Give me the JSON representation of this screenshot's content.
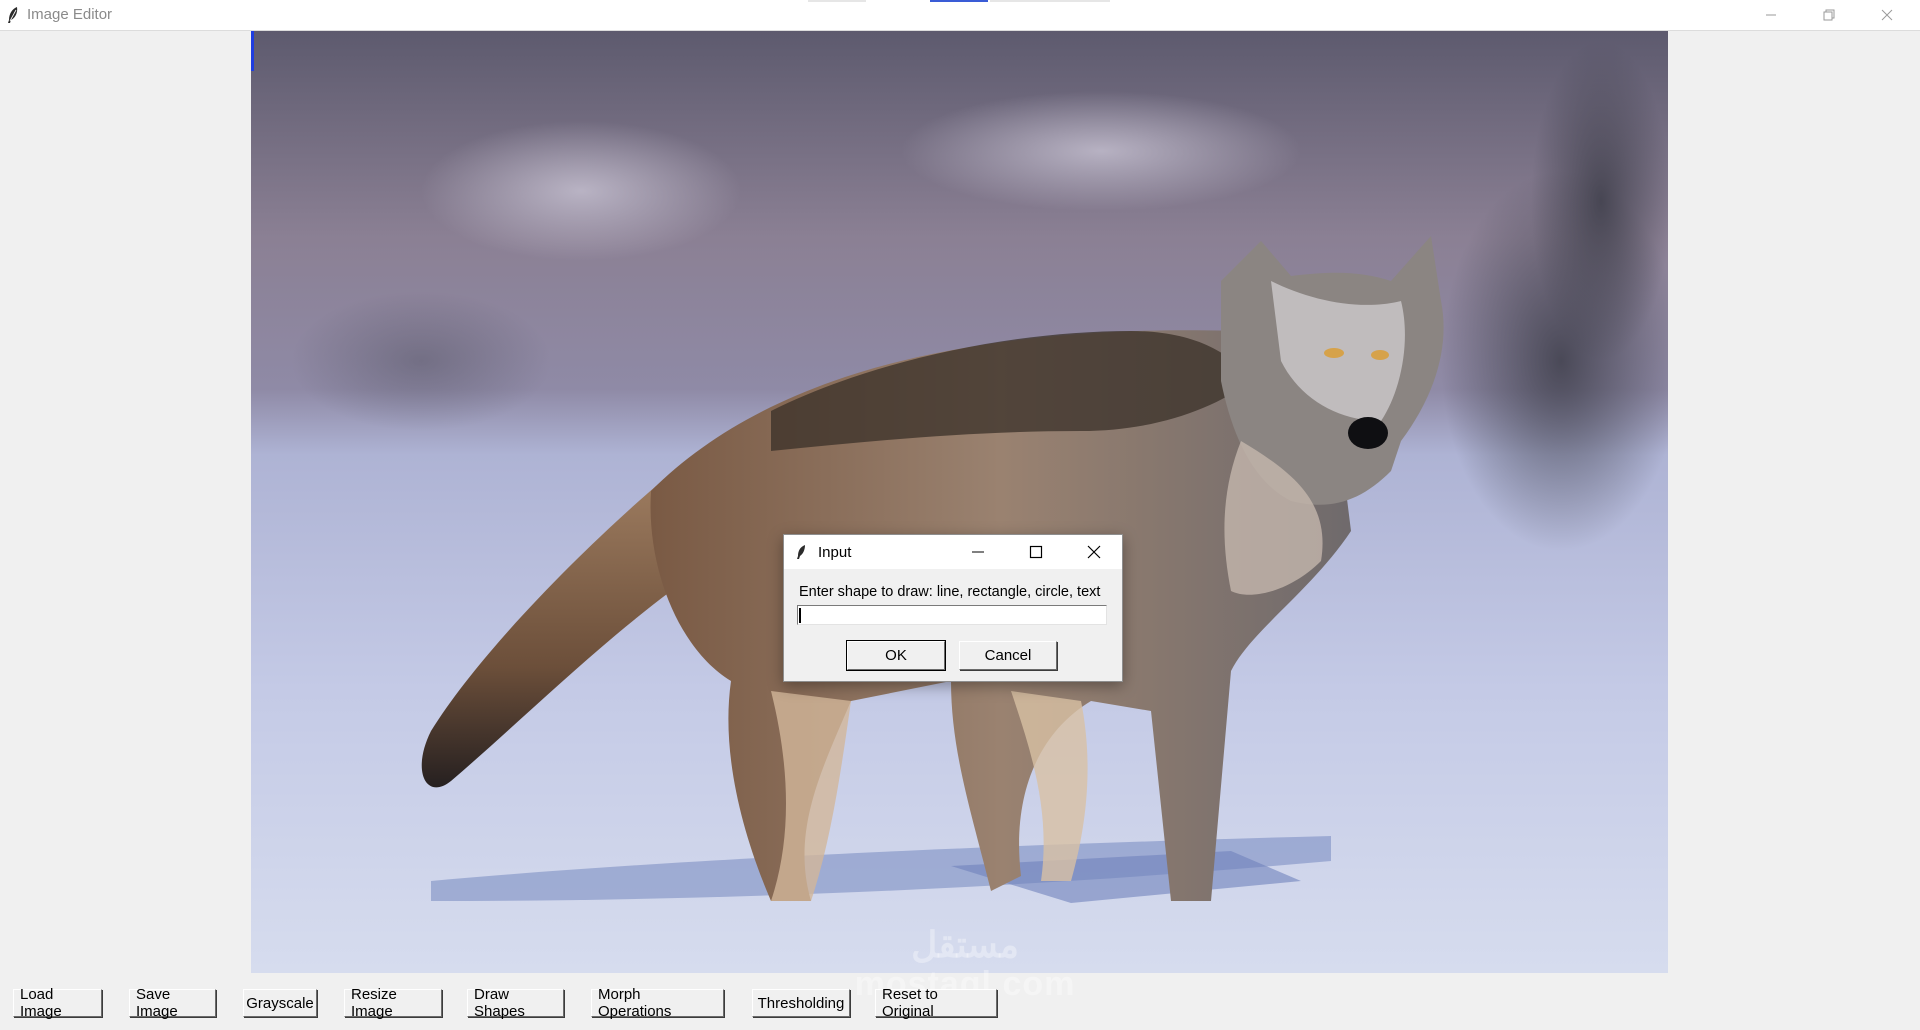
{
  "window": {
    "title": "Image Editor",
    "icons": [
      "feather-icon",
      "minimize-icon",
      "restore-icon",
      "close-icon"
    ]
  },
  "canvas": {
    "image_subject": "wolf-photo",
    "watermark_arabic": "مستقل",
    "watermark_latin": "mostaql.com"
  },
  "toolbar": {
    "buttons": [
      {
        "label": "Load Image"
      },
      {
        "label": "Save Image"
      },
      {
        "label": "Grayscale"
      },
      {
        "label": "Resize Image"
      },
      {
        "label": "Draw Shapes"
      },
      {
        "label": "Morph Operations"
      },
      {
        "label": "Thresholding"
      },
      {
        "label": "Reset to Original"
      }
    ]
  },
  "dialog": {
    "title": "Input",
    "prompt": "Enter shape to draw: line, rectangle, circle, text",
    "entry_value": "",
    "ok_label": "OK",
    "cancel_label": "Cancel"
  },
  "colors": {
    "window_bg": "#f0f0f0",
    "accent_blue": "#1f3de0",
    "snow": "#c9d3ea"
  }
}
